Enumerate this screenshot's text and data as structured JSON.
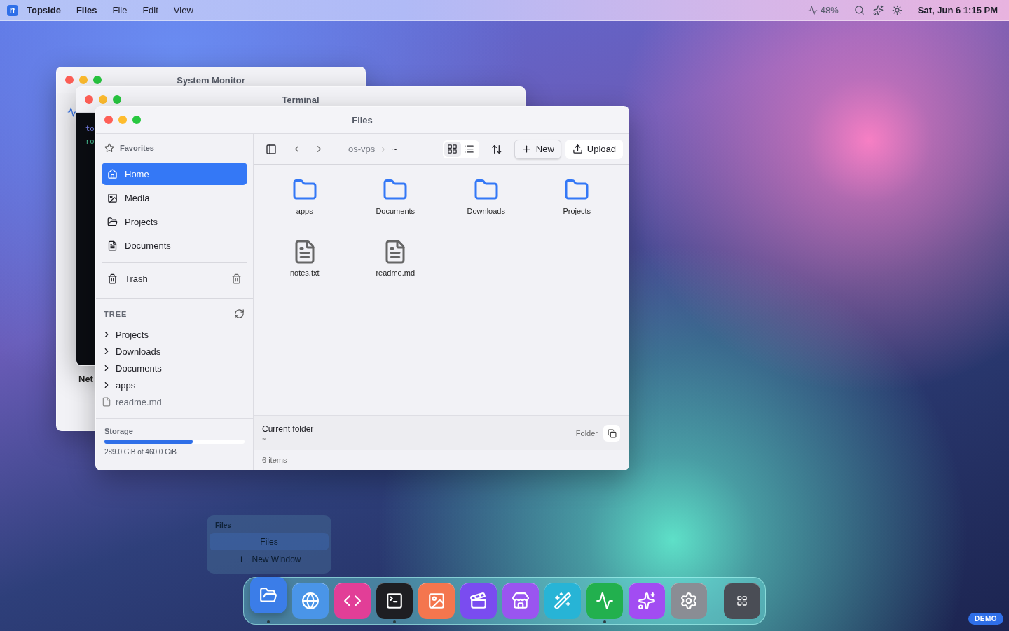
{
  "menubar": {
    "logo": "rr",
    "app_name": "Topside",
    "active_app": "Files",
    "menus": [
      "File",
      "Edit",
      "View"
    ],
    "cpu": "48%",
    "clock": "Sat, Jun 6 1:15 PM"
  },
  "system_monitor": {
    "title": "System Monitor",
    "section": "Net"
  },
  "terminal": {
    "title": "Terminal",
    "lines": [
      "to",
      "ro"
    ]
  },
  "files_window": {
    "title": "Files",
    "sidebar": {
      "favorites_heading": "Favorites",
      "favorites": [
        {
          "label": "Home",
          "selected": true
        },
        {
          "label": "Media",
          "selected": false
        },
        {
          "label": "Projects",
          "selected": false
        },
        {
          "label": "Documents",
          "selected": false
        }
      ],
      "trash": "Trash",
      "tree_heading": "TREE",
      "tree": [
        {
          "label": "Projects",
          "kind": "folder",
          "expanded": false
        },
        {
          "label": "Downloads",
          "kind": "folder",
          "expanded": false
        },
        {
          "label": "Documents",
          "kind": "folder",
          "expanded": false
        },
        {
          "label": "apps",
          "kind": "folder",
          "expanded": false
        },
        {
          "label": "readme.md",
          "kind": "file"
        }
      ],
      "storage": {
        "label": "Storage",
        "level": 0.63,
        "reading": "289.0 GiB of 460.0 GiB"
      }
    },
    "toolbar": {
      "breadcrumb": [
        "os-vps",
        "~"
      ],
      "views": [
        {
          "kind": "grid",
          "selected": true
        },
        {
          "kind": "list",
          "selected": false
        }
      ],
      "buttons": [
        {
          "label": "New",
          "kind": "new"
        },
        {
          "label": "Upload",
          "kind": "upload"
        }
      ]
    },
    "items": [
      {
        "name": "apps",
        "kind": "folder"
      },
      {
        "name": "Documents",
        "kind": "folder"
      },
      {
        "name": "Downloads",
        "kind": "folder"
      },
      {
        "name": "Projects",
        "kind": "folder"
      },
      {
        "name": "notes.txt",
        "kind": "file"
      },
      {
        "name": "readme.md",
        "kind": "file"
      }
    ],
    "info": {
      "title": "Current folder",
      "path": "~",
      "type": "Folder"
    },
    "status": "6 items"
  },
  "dock_menu": {
    "heading": "Files",
    "items": [
      {
        "label": "Files",
        "kind": "window",
        "selected": true
      },
      {
        "label": "New Window",
        "kind": "new",
        "selected": false
      }
    ]
  },
  "dock": [
    {
      "color": "#3b7de8",
      "running": true,
      "selected": true
    },
    {
      "color": "#4a95e8",
      "running": false,
      "selected": false
    },
    {
      "color": "#e23e97",
      "running": false,
      "selected": false
    },
    {
      "color": "#1e1e22",
      "running": true,
      "selected": false
    },
    {
      "color": "#f4764e",
      "running": false,
      "selected": false
    },
    {
      "color": "#7a4cf0",
      "running": false,
      "selected": false
    },
    {
      "color": "#9a55f0",
      "running": false,
      "selected": false
    },
    {
      "color": "#27b4d6",
      "running": false,
      "selected": false
    },
    {
      "color": "#22b04e",
      "running": true,
      "selected": false
    },
    {
      "color": "#a24cf2",
      "running": false,
      "selected": false
    },
    {
      "color": "#8a8d94",
      "running": false,
      "selected": false
    }
  ],
  "badge": "DEMO"
}
